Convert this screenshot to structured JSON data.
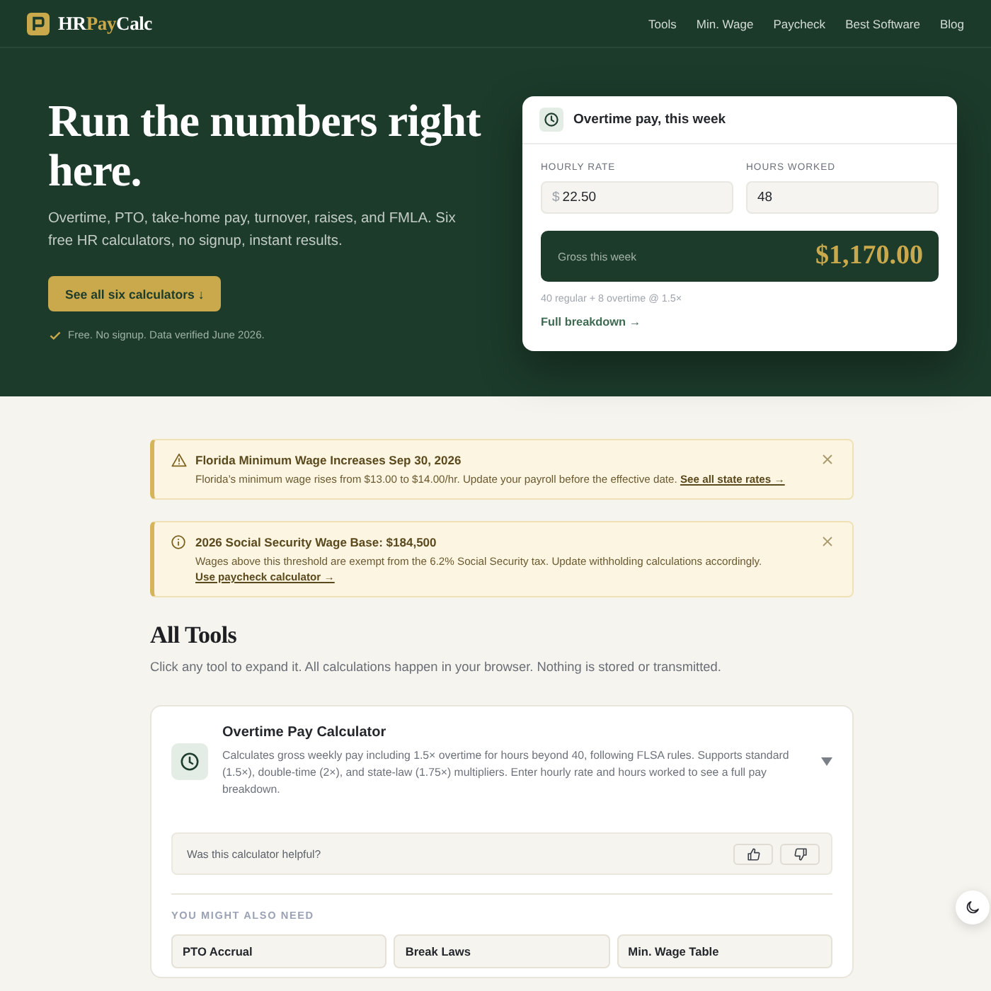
{
  "header": {
    "logo": {
      "lead": "HR",
      "accent": "Pay",
      "tail": "Calc"
    },
    "nav": [
      "Tools",
      "Min. Wage",
      "Paycheck",
      "Best Software",
      "Blog"
    ]
  },
  "hero": {
    "title": "Run the numbers right here.",
    "subtitle": "Overtime, PTO, take-home pay, turnover, raises, and FMLA. Six free HR calculators, no signup, instant results.",
    "cta": "See all six calculators ↓",
    "note": "Free. No signup. Data verified June 2026."
  },
  "preview_card": {
    "title": "Overtime pay, this week",
    "fields": [
      {
        "label": "HOURLY RATE",
        "prefix": "$",
        "value": "22.50"
      },
      {
        "label": "HOURS WORKED",
        "value": "48"
      }
    ],
    "result": {
      "label": "Gross this week",
      "value": "$1,170.00"
    },
    "detail": "40 regular + 8 overtime @ 1.5×",
    "link": "Full breakdown →"
  },
  "alerts": [
    {
      "kind": "warning",
      "title": "Florida Minimum Wage Increases Sep 30, 2026",
      "body": "Florida’s minimum wage rises from $13.00 to $14.00/hr. Update your payroll before the effective date.",
      "link": "See all state rates →"
    },
    {
      "kind": "info",
      "title": "2026 Social Security Wage Base: $184,500",
      "body": "Wages above this threshold are exempt from the 6.2% Social Security tax. Update withholding calculations accordingly.",
      "link": "Use paycheck calculator →"
    }
  ],
  "tools_section": {
    "title": "All Tools",
    "subtitle": "Click any tool to expand it. All calculations happen in your browser. Nothing is stored or transmitted.",
    "tool": {
      "title": "Overtime Pay Calculator",
      "description": "Calculates gross weekly pay including 1.5× overtime for hours beyond 40, following FLSA rules. Supports standard (1.5×), double-time (2×), and state-law (1.75×) multipliers. Enter hourly rate and hours worked to see a full pay breakdown.",
      "feedback": {
        "question": "Was this calculator helpful?"
      },
      "related": {
        "heading": "YOU MIGHT ALSO NEED",
        "items": [
          "PTO Accrual",
          "Break Laws",
          "Min. Wage Table"
        ]
      }
    }
  }
}
